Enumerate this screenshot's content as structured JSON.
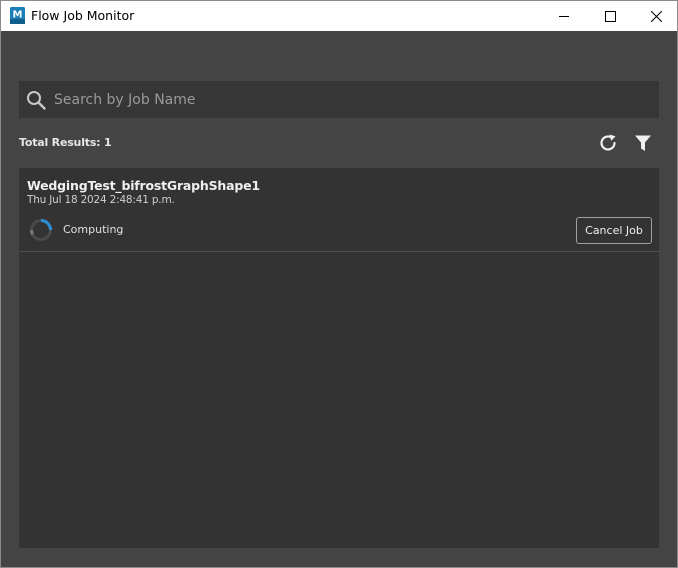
{
  "window": {
    "title": "Flow Job Monitor",
    "app_icon_letter": "M",
    "minimize_icon": "minimize-icon",
    "maximize_icon": "maximize-icon",
    "close_icon": "close-icon"
  },
  "search": {
    "placeholder": "Search by Job Name",
    "value": "",
    "icon": "search-icon"
  },
  "results": {
    "total_label": "Total Results: 1",
    "refresh_icon": "refresh-icon",
    "filter_icon": "filter-icon"
  },
  "jobs": [
    {
      "name": "WedgingTest_bifrostGraphShape1",
      "date": "Thu Jul 18 2024 2:48:41 p.m.",
      "status": "Computing",
      "status_icon": "spinner-icon",
      "action_label": "Cancel Job"
    }
  ],
  "colors": {
    "background": "#444444",
    "panel": "#333333",
    "search_bg": "#363636",
    "spinner_accent": "#2b8fd6"
  }
}
